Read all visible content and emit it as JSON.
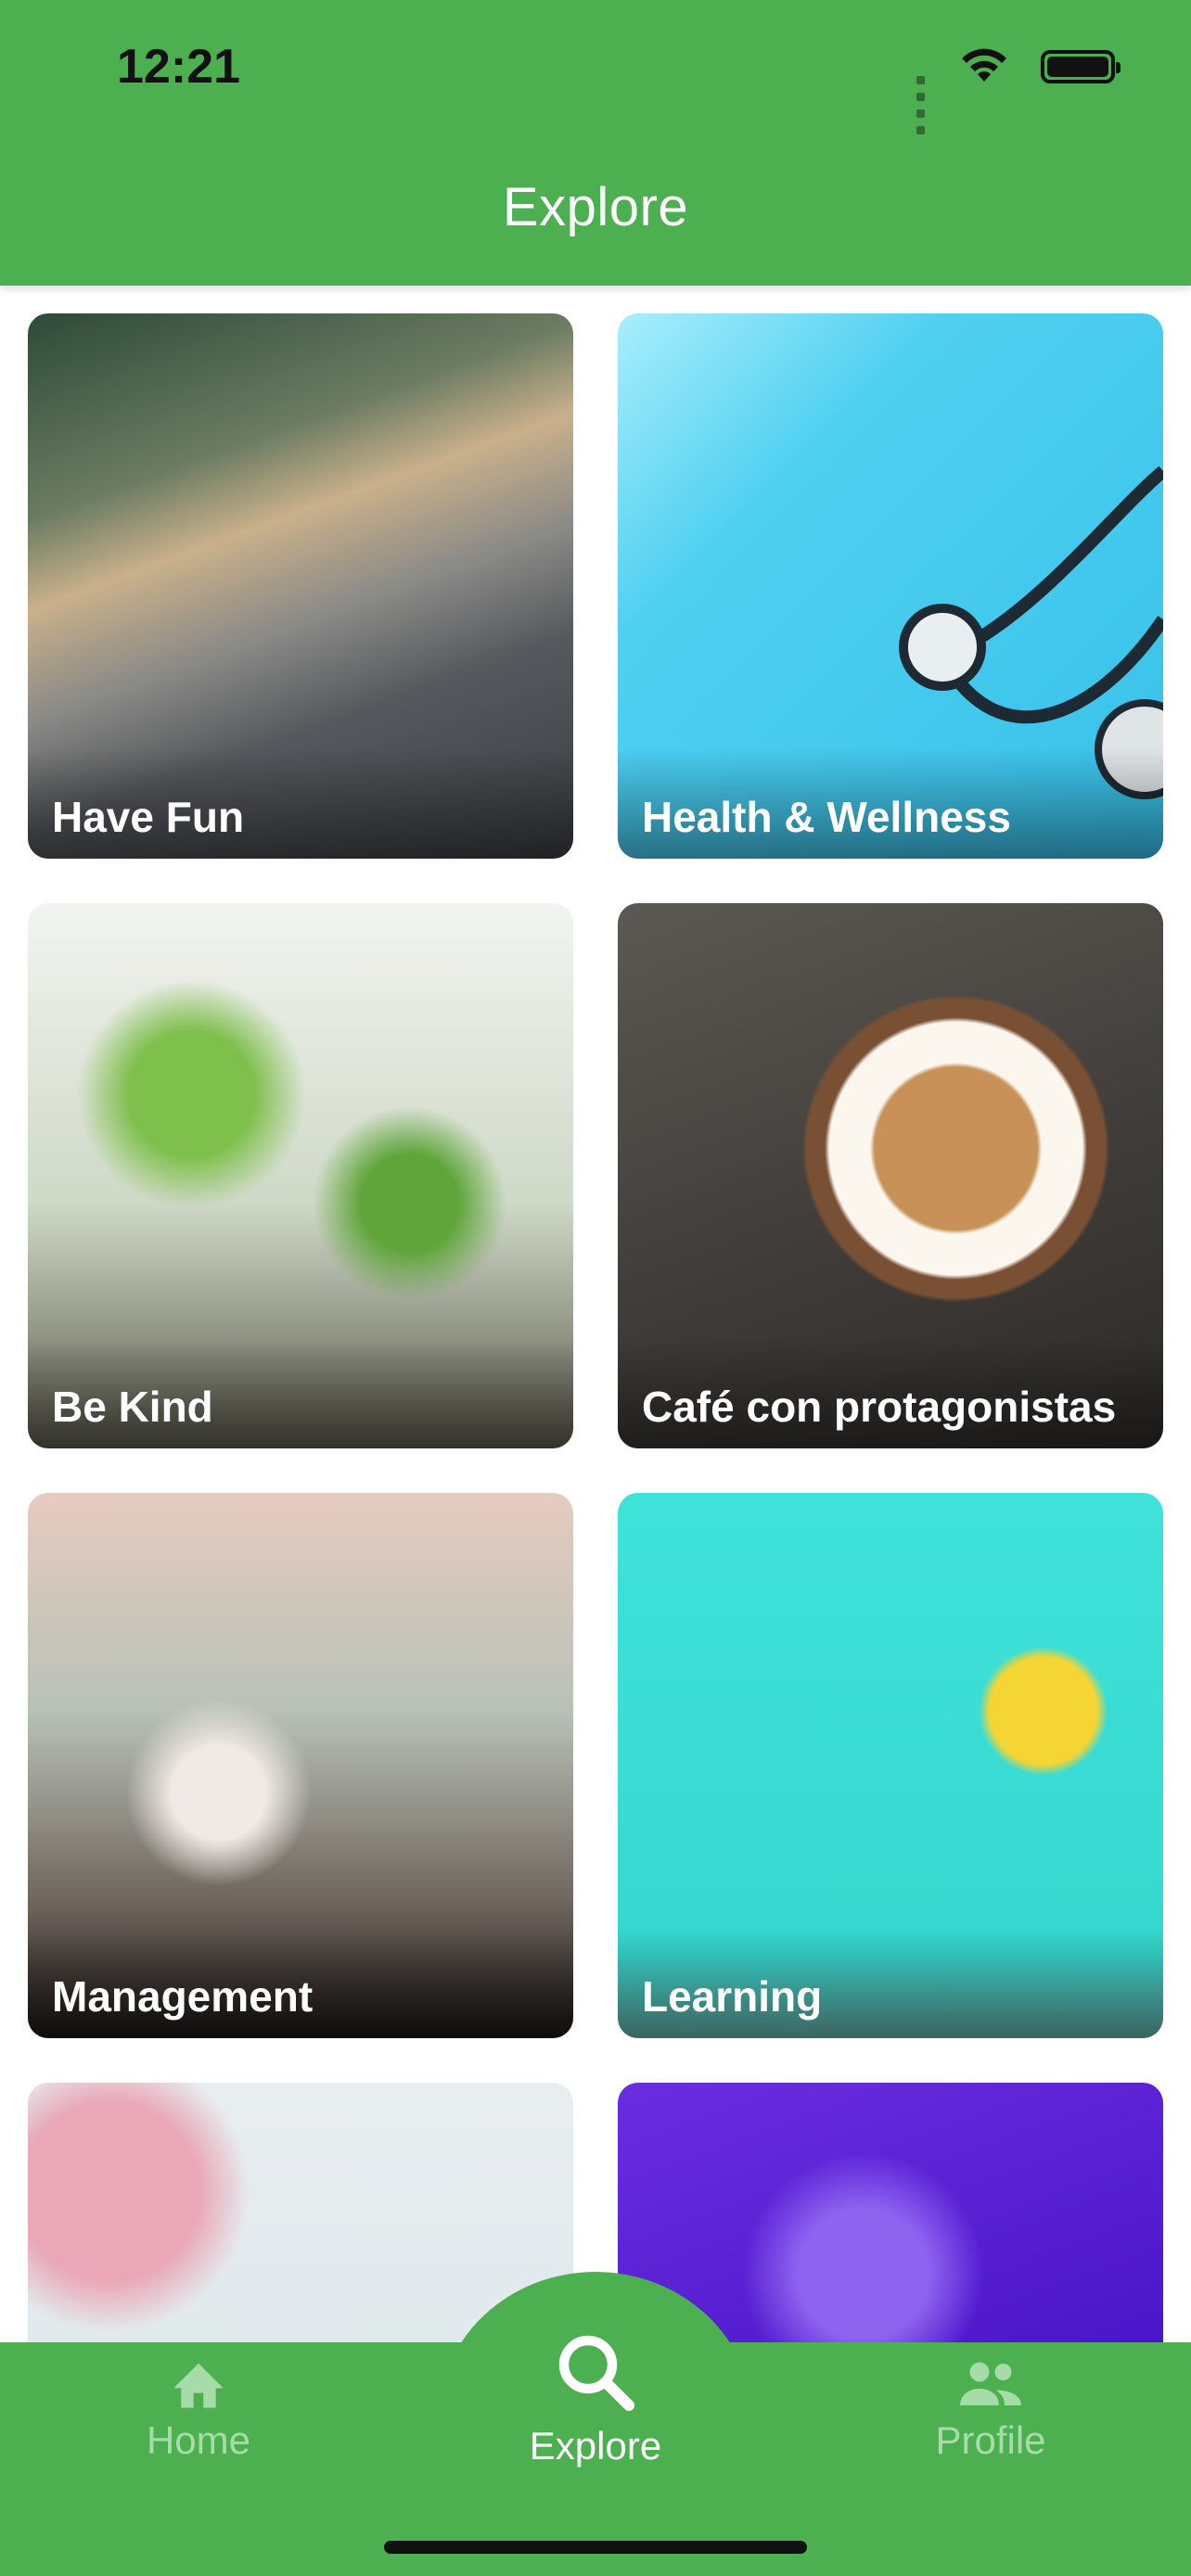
{
  "status_bar": {
    "time": "12:21"
  },
  "header": {
    "title": "Explore"
  },
  "categories": [
    {
      "label": "Have Fun"
    },
    {
      "label": "Health & Wellness"
    },
    {
      "label": "Be Kind"
    },
    {
      "label": "Café con protagonistas"
    },
    {
      "label": "Management"
    },
    {
      "label": "Learning"
    },
    {
      "label": ""
    },
    {
      "label": ""
    }
  ],
  "bottom_nav": {
    "items": [
      {
        "label": "Home",
        "icon": "home-icon",
        "active": false
      },
      {
        "label": "Explore",
        "icon": "search-icon",
        "active": true
      },
      {
        "label": "Profile",
        "icon": "people-icon",
        "active": false
      }
    ]
  },
  "colors": {
    "primary": "#4caf50",
    "nav_inactive": "#a6dca8",
    "nav_active": "#ffffff"
  }
}
